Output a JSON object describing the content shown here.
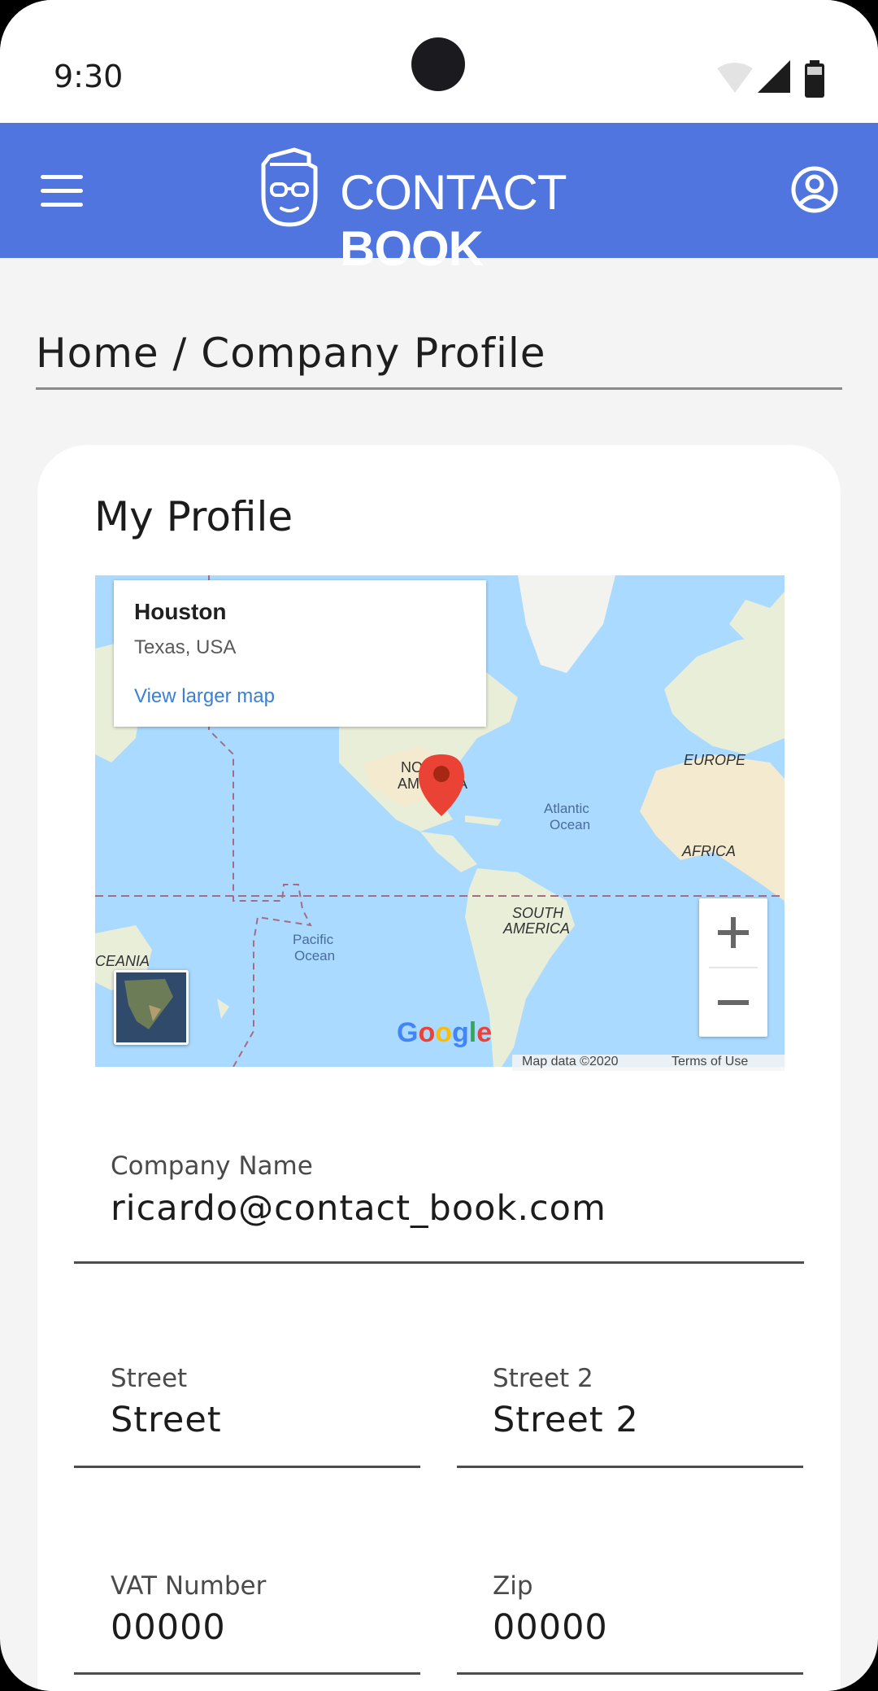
{
  "status_bar": {
    "time": "9:30"
  },
  "app_bar": {
    "title_light": "CONTACT ",
    "title_bold": "BOOK"
  },
  "breadcrumb": "Home / Company Profile",
  "card": {
    "title": "My Profile"
  },
  "map": {
    "place_name": "Houston",
    "place_region": "Texas, USA",
    "view_larger_link": "View larger map",
    "labels": {
      "north_america_1": "NO",
      "north_america_2": "AM",
      "north_america_3": "A",
      "europe": "EUROPE",
      "atlantic_1": "Atlantic",
      "atlantic_2": "Ocean",
      "africa": "AFRICA",
      "south_america_1": "SOUTH",
      "south_america_2": "AMERICA",
      "pacific_1": "Pacific",
      "pacific_2": "Ocean",
      "oceania": "CEANIA"
    },
    "google_logo": "Google",
    "map_data": "Map data ©2020",
    "terms": "Terms of Use",
    "zoom_in": "+",
    "zoom_out": "−"
  },
  "form": {
    "company_name": {
      "label": "Company Name",
      "value": "ricardo@contact_book.com"
    },
    "street": {
      "label": "Street",
      "value": "Street"
    },
    "street2": {
      "label": "Street 2",
      "value": "Street 2"
    },
    "vat": {
      "label": "VAT Number",
      "value": "00000"
    },
    "zip": {
      "label": "Zip",
      "value": "00000"
    }
  },
  "colors": {
    "app_bar": "#5075de",
    "background": "#f4f4f4",
    "card": "#ffffff",
    "map_water": "#aadaff",
    "map_land": "#e9eed9",
    "marker": "#ea4335",
    "link": "#3a7fd5"
  },
  "icons": {
    "menu": "menu-icon",
    "logo": "nerd-face-logo-icon",
    "account": "account-circle-icon",
    "wifi": "wifi-icon",
    "signal": "cell-signal-icon",
    "battery": "battery-icon",
    "marker": "map-marker-icon"
  }
}
